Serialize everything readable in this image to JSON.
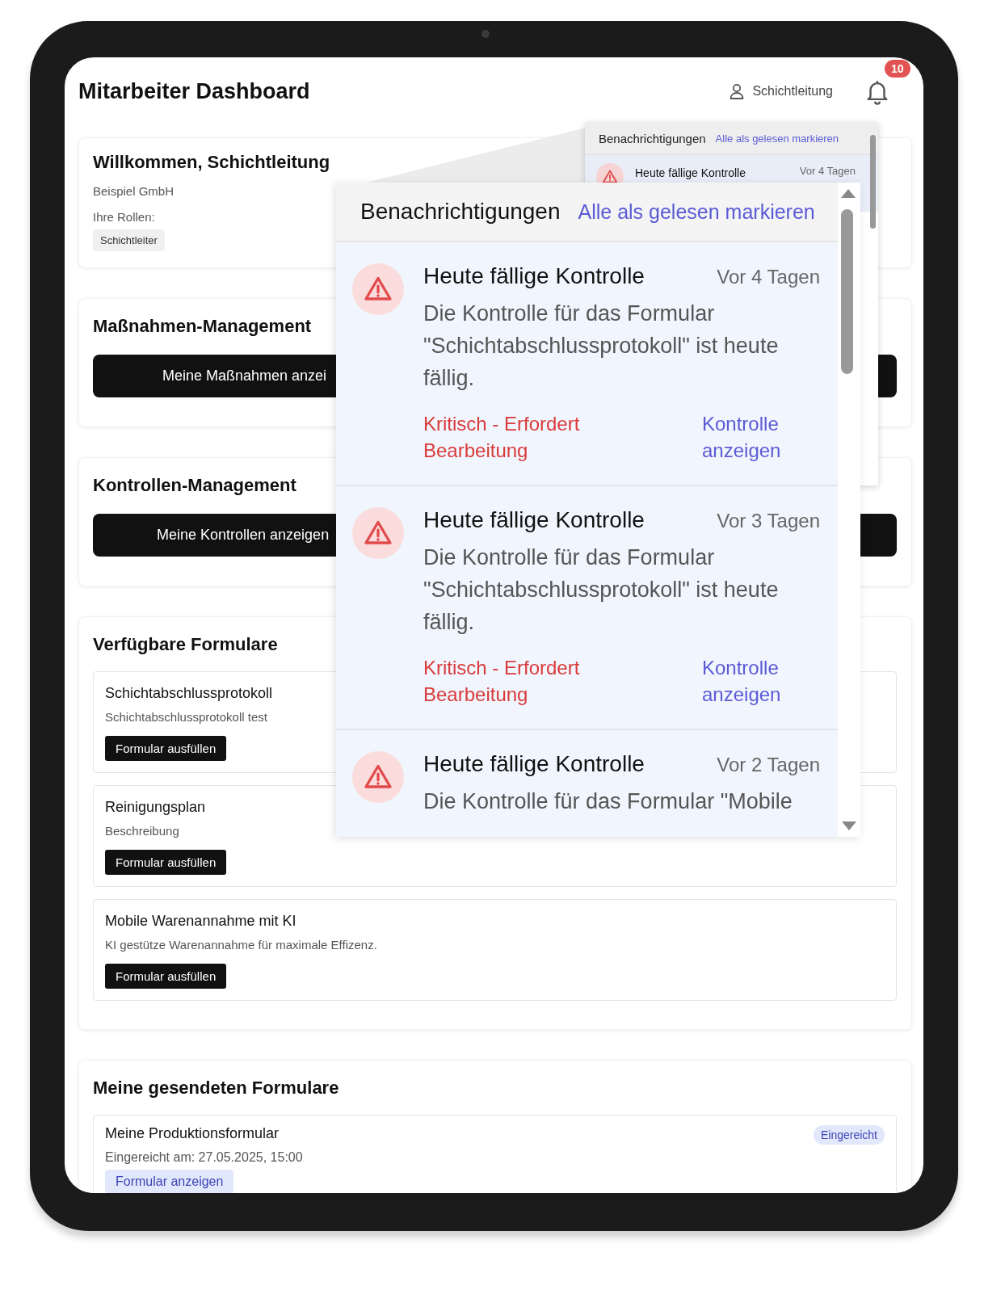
{
  "header": {
    "title": "Mitarbeiter Dashboard",
    "user_label": "Schichtleitung",
    "notification_count": "10"
  },
  "notification_dropdown": {
    "title": "Benachrichtigungen",
    "mark_all": "Alle als gelesen markieren",
    "items": [
      {
        "title": "Heute fällige Kontrolle",
        "time": "Vor 4 Tagen"
      }
    ]
  },
  "notification_zoom": {
    "title": "Benachrichtigungen",
    "mark_all": "Alle als gelesen markieren",
    "items": [
      {
        "title": "Heute fällige Kontrolle",
        "time": "Vor 4 Tagen",
        "message": "Die Kontrolle für das Formular \"Schichtabschlussprotokoll\" ist heute fällig.",
        "priority": "Kritisch - Erfordert Bearbeitung",
        "action": "Kontrolle anzeigen"
      },
      {
        "title": "Heute fällige Kontrolle",
        "time": "Vor 3 Tagen",
        "message": "Die Kontrolle für das Formular \"Schichtabschlussprotokoll\" ist heute fällig.",
        "priority": "Kritisch - Erfordert Bearbeitung",
        "action": "Kontrolle anzeigen"
      },
      {
        "title": "Heute fällige Kontrolle",
        "time": "Vor 2 Tagen",
        "message": "Die Kontrolle für das Formular \"Mobile"
      }
    ]
  },
  "welcome": {
    "heading": "Willkommen, Schichtleitung",
    "company": "Beispiel GmbH",
    "roles_label": "Ihre Rollen:",
    "roles": [
      "Schichtleiter"
    ]
  },
  "measures": {
    "title": "Maßnahmen-Management",
    "button": "Meine Maßnahmen anzei"
  },
  "controls": {
    "title": "Kontrollen-Management",
    "button": "Meine Kontrollen anzeigen"
  },
  "forms": {
    "title": "Verfügbare Formulare",
    "items": [
      {
        "name": "Schichtabschlussprotokoll",
        "description": "Schichtabschlussprotokoll test",
        "button": "Formular ausfüllen"
      },
      {
        "name": "Reinigungsplan",
        "description": "Beschreibung",
        "button": "Formular ausfüllen"
      },
      {
        "name": "Mobile Warenannahme mit KI",
        "description": "KI gestütze Warenannahme für maximale Effizenz.",
        "button": "Formular ausfüllen"
      }
    ]
  },
  "submitted": {
    "title": "Meine gesendeten Formulare",
    "items": [
      {
        "name": "Meine Produktionsformular",
        "status": "Eingereicht",
        "submitted_at": "Eingereicht am: 27.05.2025, 15:00",
        "button": "Formular anzeigen"
      }
    ]
  }
}
